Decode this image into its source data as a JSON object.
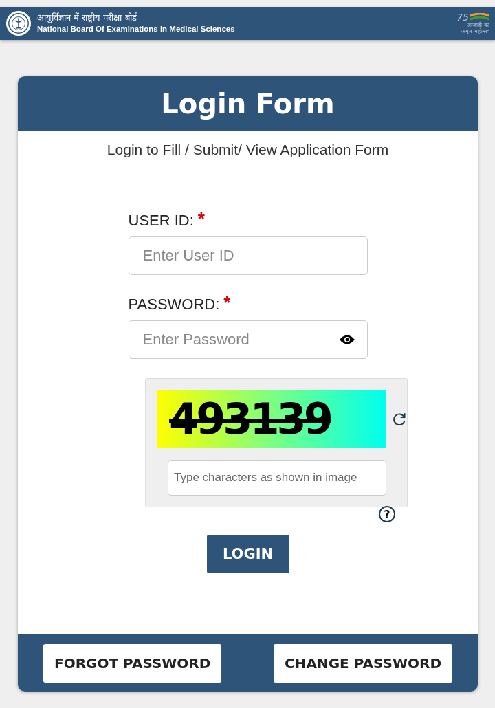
{
  "header": {
    "title_hindi": "आयुर्विज्ञान में राष्ट्रीय परीक्षा बोर्ड",
    "title": "National Board Of Examinations In Medical Sciences",
    "badge_number": "75",
    "badge_lines": [
      "आज़ादी का",
      "अमृत महोत्सव"
    ]
  },
  "form": {
    "title": "Login Form",
    "subtitle": "Login to Fill / Submit/ View Application Form",
    "fields": [
      {
        "label": "USER ID:",
        "required": true,
        "placeholder": "Enter User ID",
        "kind": "text"
      },
      {
        "label": "PASSWORD:",
        "required": true,
        "placeholder": "Enter Password",
        "kind": "password"
      }
    ],
    "required_mark": "*",
    "captcha": {
      "code": "493139",
      "placeholder": "Type characters as shown in image",
      "help": "?"
    },
    "submit": "LOGIN",
    "footer_buttons": [
      "FORGOT PASSWORD",
      "CHANGE PASSWORD"
    ]
  }
}
